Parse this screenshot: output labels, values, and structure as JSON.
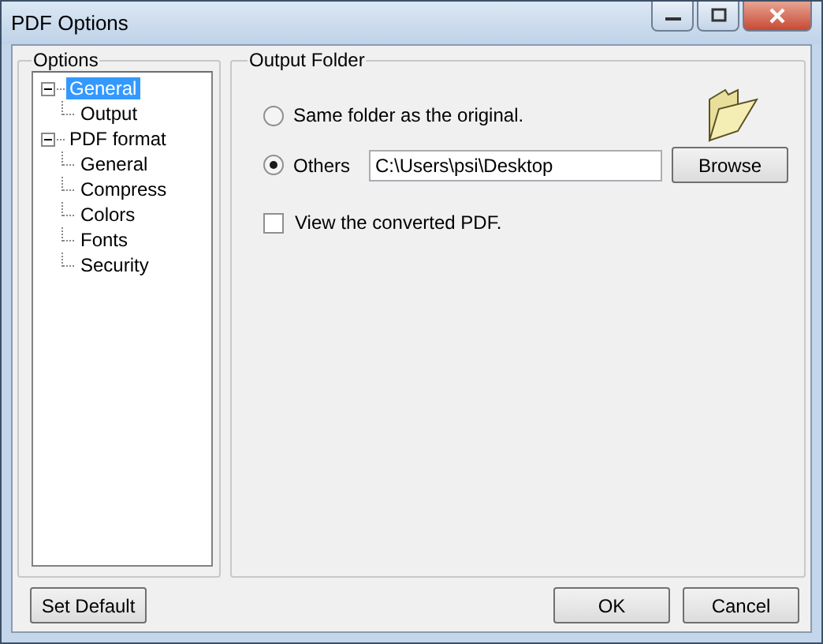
{
  "window": {
    "title": "PDF Options"
  },
  "options": {
    "label": "Options",
    "tree": [
      {
        "label": "General",
        "selected": true,
        "expanded": true,
        "children": [
          {
            "label": "Output",
            "selected": false
          }
        ]
      },
      {
        "label": "PDF format",
        "selected": false,
        "expanded": true,
        "children": [
          {
            "label": "General",
            "selected": false
          },
          {
            "label": "Compress",
            "selected": false
          },
          {
            "label": "Colors",
            "selected": false
          },
          {
            "label": "Fonts",
            "selected": false
          },
          {
            "label": "Security",
            "selected": false
          }
        ]
      }
    ]
  },
  "output_folder": {
    "label": "Output Folder",
    "radios": [
      {
        "label": "Same folder as the original.",
        "selected": false
      },
      {
        "label": "Others",
        "selected": true
      }
    ],
    "path": "C:\\Users\\psi\\Desktop",
    "browse": "Browse",
    "view_checkbox": {
      "label": "View the converted PDF.",
      "checked": false
    }
  },
  "buttons": {
    "set_default": "Set Default",
    "ok": "OK",
    "cancel": "Cancel"
  }
}
